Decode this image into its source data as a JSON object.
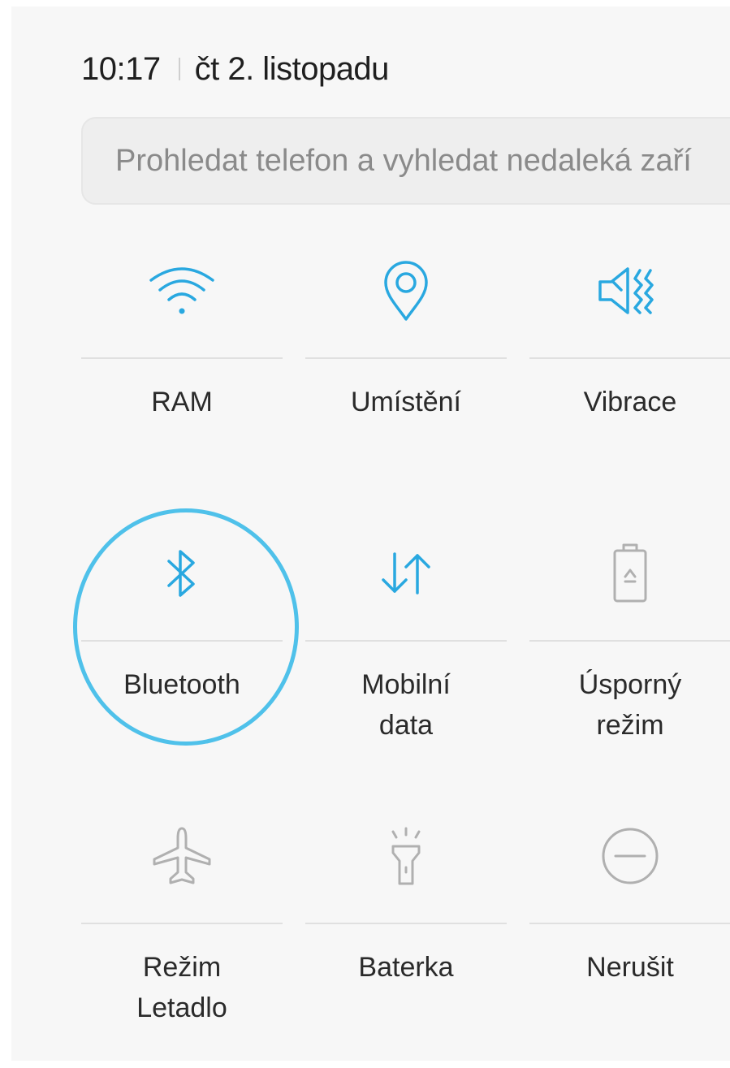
{
  "status": {
    "time": "10:17",
    "date": "čt 2. listopadu"
  },
  "search": {
    "placeholder": "Prohledat telefon a vyhledat nedaleká zaří"
  },
  "colors": {
    "accent": "#29a8e0",
    "inactive": "#b0b0b0",
    "highlight": "#4fc1ea"
  },
  "tiles": [
    {
      "icon": "wifi-icon",
      "label_line1": "RAM",
      "label_line2": "",
      "active": true
    },
    {
      "icon": "location-pin-icon",
      "label_line1": "Umístění",
      "label_line2": "",
      "active": true
    },
    {
      "icon": "vibrate-icon",
      "label_line1": "Vibrace",
      "label_line2": "",
      "active": true
    },
    {
      "icon": "bluetooth-icon",
      "label_line1": "Bluetooth",
      "label_line2": "",
      "active": true
    },
    {
      "icon": "mobile-data-icon",
      "label_line1": "Mobilní",
      "label_line2": "data",
      "active": true
    },
    {
      "icon": "power-saving-icon",
      "label_line1": "Úsporný",
      "label_line2": "režim",
      "active": false
    },
    {
      "icon": "airplane-icon",
      "label_line1": "Režim",
      "label_line2": "Letadlo",
      "active": false
    },
    {
      "icon": "flashlight-icon",
      "label_line1": "Baterka",
      "label_line2": "",
      "active": false
    },
    {
      "icon": "do-not-disturb-icon",
      "label_line1": "Nerušit",
      "label_line2": "",
      "active": false
    }
  ]
}
